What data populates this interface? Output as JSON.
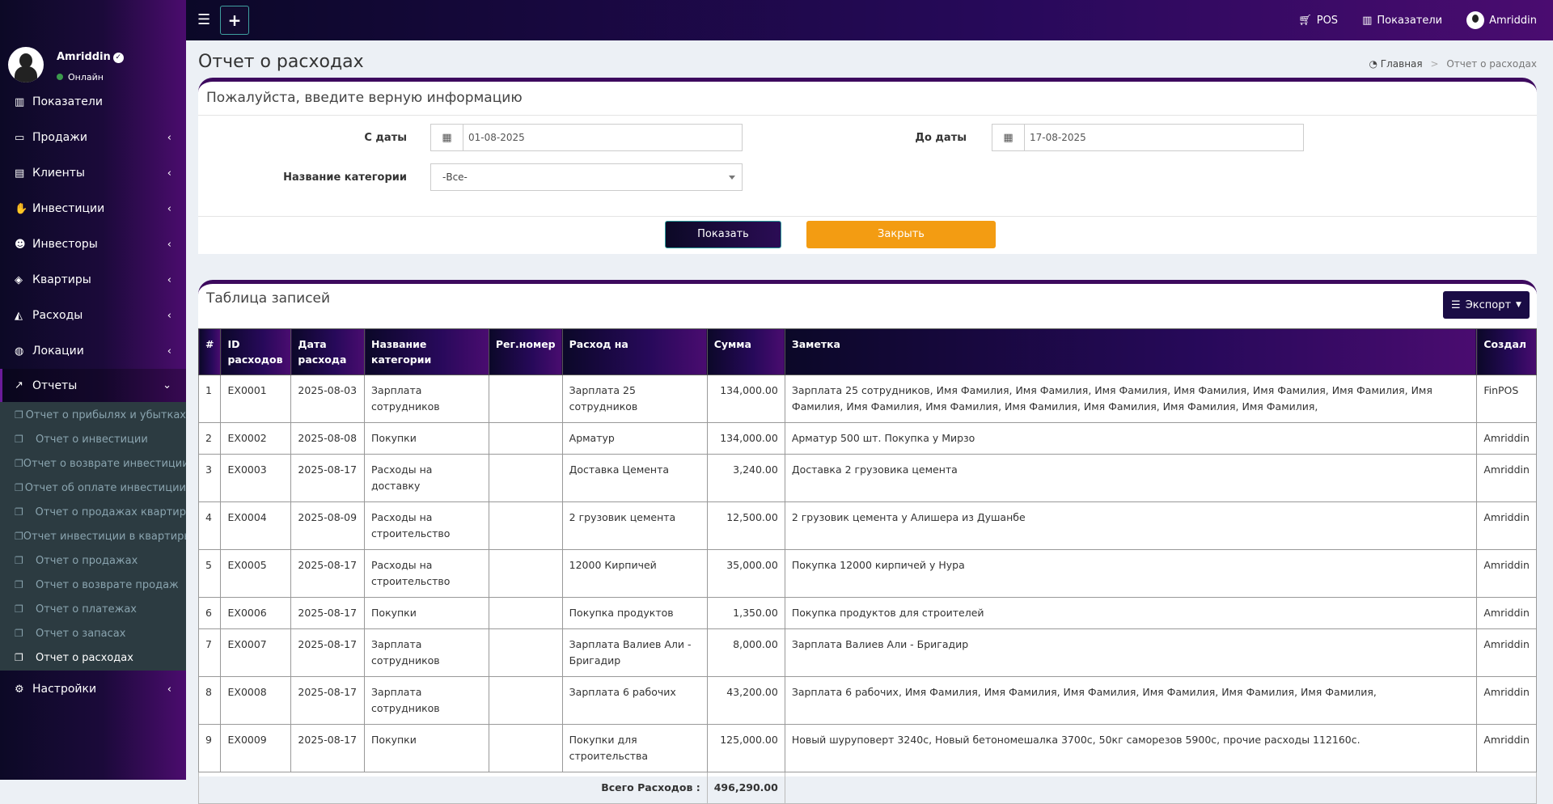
{
  "sidebar": {
    "user_name": "Amriddin",
    "status": "Онлайн",
    "items": [
      {
        "label": "Показатели",
        "icon": "bar-chart-icon"
      },
      {
        "label": "Продажи",
        "icon": "credit-card-icon"
      },
      {
        "label": "Клиенты",
        "icon": "id-card-icon"
      },
      {
        "label": "Инвестиции",
        "icon": "handshake-icon"
      },
      {
        "label": "Инвесторы",
        "icon": "users-icon"
      },
      {
        "label": "Квартиры",
        "icon": "cube-icon"
      },
      {
        "label": "Расходы",
        "icon": "area-chart-icon"
      },
      {
        "label": "Локации",
        "icon": "globe-icon"
      },
      {
        "label": "Отчеты",
        "icon": "line-chart-icon"
      },
      {
        "label": "Настройки",
        "icon": "cogs-icon"
      }
    ],
    "reports": [
      "Отчет о прибылях и убытках",
      "Отчет о инвестиции",
      "Отчет о возврате инвестиции",
      "Отчет об оплате инвестиции",
      "Отчет о продажах квартир",
      "Отчет инвестиции в квартиры",
      "Отчет о продажах",
      "Отчет о возврате продаж",
      "Отчет о платежах",
      "Отчет о запасах",
      "Отчет о расходах"
    ]
  },
  "topbar": {
    "pos_label": "POS",
    "dashboard_label": "Показатели",
    "user_name": "Amriddin"
  },
  "page": {
    "title": "Отчет о расходах",
    "breadcrumb_home": "Главная",
    "breadcrumb_current": "Отчет о расходах"
  },
  "form": {
    "title": "Пожалуйста, введите верную информацию",
    "from_label": "С даты",
    "from_value": "01-08-2025",
    "to_label": "До даты",
    "to_value": "17-08-2025",
    "category_label": "Название категории",
    "category_value": "-Все-",
    "show_label": "Показать",
    "close_label": "Закрыть"
  },
  "table": {
    "title": "Таблица записей",
    "export_label": "Экспорт",
    "headers": [
      "#",
      "ID расходов",
      "Дата расхода",
      "Название категории",
      "Рег.номер",
      "Расход на",
      "Сумма",
      "Заметка",
      "Создал"
    ],
    "rows": [
      [
        "1",
        "EX0001",
        "2025-08-03",
        "Зарплата сотрудников",
        "",
        "Зарплата 25 сотрудников",
        "134,000.00",
        "Зарплата 25 сотрудников, Имя Фамилия, Имя Фамилия, Имя Фамилия, Имя Фамилия, Имя Фамилия, Имя Фамилия, Имя Фамилия, Имя Фамилия, Имя Фамилия, Имя Фамилия, Имя Фамилия, Имя Фамилия, Имя Фамилия,",
        "FinPOS"
      ],
      [
        "2",
        "EX0002",
        "2025-08-08",
        "Покупки",
        "",
        "Арматур",
        "134,000.00",
        "Арматур 500 шт. Покупка у Мирзо",
        "Amriddin"
      ],
      [
        "3",
        "EX0003",
        "2025-08-17",
        "Расходы на доставку",
        "",
        "Доставка Цемента",
        "3,240.00",
        "Доставка 2 грузовика цемента",
        "Amriddin"
      ],
      [
        "4",
        "EX0004",
        "2025-08-09",
        "Расходы на строительство",
        "",
        "2 грузовик цемента",
        "12,500.00",
        "2 грузовик цемента у Алишера из Душанбе",
        "Amriddin"
      ],
      [
        "5",
        "EX0005",
        "2025-08-17",
        "Расходы на строительство",
        "",
        "12000 Кирпичей",
        "35,000.00",
        "Покупка 12000 кирпичей у Нура",
        "Amriddin"
      ],
      [
        "6",
        "EX0006",
        "2025-08-17",
        "Покупки",
        "",
        "Покупка продуктов",
        "1,350.00",
        "Покупка продуктов для строителей",
        "Amriddin"
      ],
      [
        "7",
        "EX0007",
        "2025-08-17",
        "Зарплата сотрудников",
        "",
        "Зарплата Валиев Али - Бригадир",
        "8,000.00",
        "Зарплата Валиев Али - Бригадир",
        "Amriddin"
      ],
      [
        "8",
        "EX0008",
        "2025-08-17",
        "Зарплата сотрудников",
        "",
        "Зарплата 6 рабочих",
        "43,200.00",
        "Зарплата 6 рабочих, Имя Фамилия, Имя Фамилия, Имя Фамилия, Имя Фамилия, Имя Фамилия, Имя Фамилия,",
        "Amriddin"
      ],
      [
        "9",
        "EX0009",
        "2025-08-17",
        "Покупки",
        "",
        "Покупки для строительства",
        "125,000.00",
        "Новый шуруповерт 3240с, Новый бетономешалка 3700с, 50кг саморезов 5900с, прочие расходы 112160с.",
        "Amriddin"
      ]
    ],
    "total_label": "Всего Расходов :",
    "total_value": "496,290.00"
  }
}
